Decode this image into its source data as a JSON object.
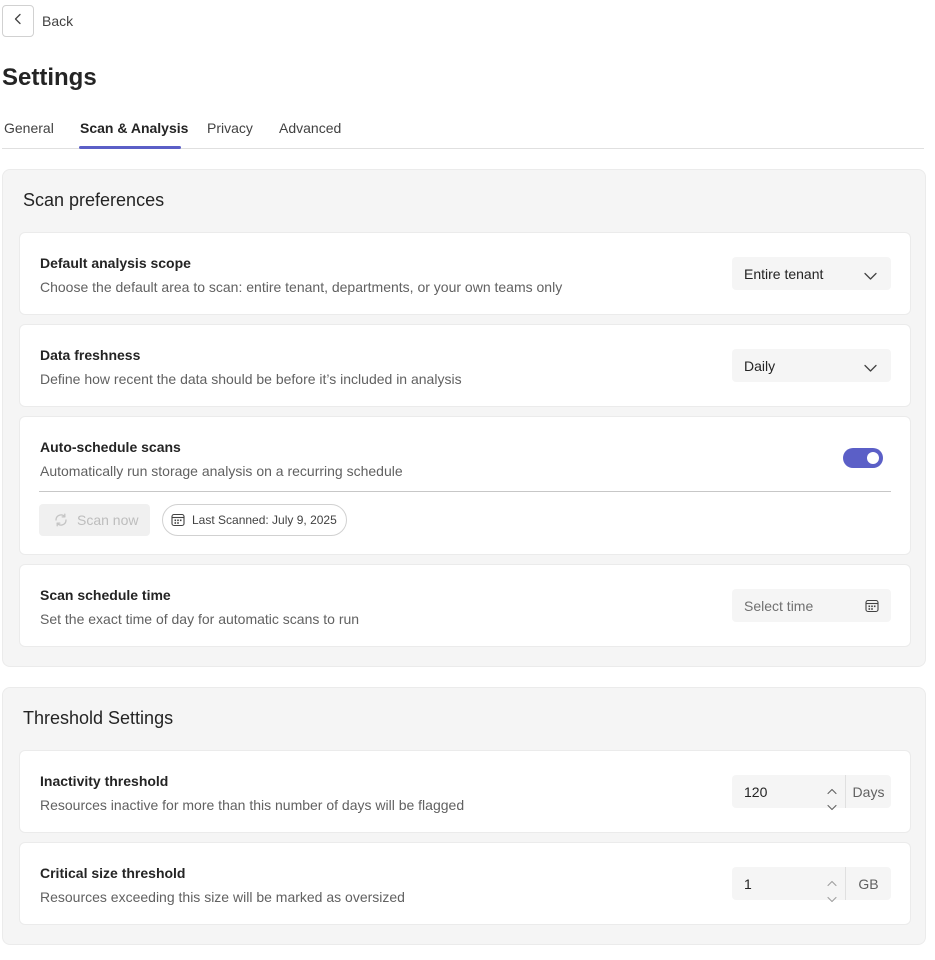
{
  "nav": {
    "back_label": "Back"
  },
  "page": {
    "title": "Settings"
  },
  "tabs": [
    {
      "label": "General"
    },
    {
      "label": "Scan & Analysis",
      "active": true
    },
    {
      "label": "Privacy"
    },
    {
      "label": "Advanced"
    }
  ],
  "colors": {
    "accent": "#5b5fc7",
    "section_bg": "#f5f5f5",
    "card_bg": "#ffffff"
  },
  "scan_preferences": {
    "title": "Scan preferences",
    "default_scope": {
      "title": "Default analysis scope",
      "description": "Choose the default area to scan: entire tenant, departments, or your own teams only",
      "selected": "Entire tenant",
      "icon": "chevron-down-icon"
    },
    "data_freshness": {
      "title": "Data freshness",
      "description": "Define how recent the data should be before it’s included in analysis",
      "selected": "Daily",
      "icon": "chevron-down-icon"
    },
    "auto_schedule": {
      "title": "Auto-schedule scans",
      "description": "Automatically run storage analysis on a recurring schedule",
      "enabled": true,
      "scan_now_label": "Scan now",
      "scan_now_disabled": true,
      "last_scanned": "Last Scanned: July 9, 2025"
    },
    "schedule_time": {
      "title": "Scan schedule time",
      "description": "Set the exact time of day for automatic scans to run",
      "placeholder": "Select time",
      "icon": "calendar-icon"
    }
  },
  "threshold_settings": {
    "title": "Threshold Settings",
    "inactivity": {
      "title": "Inactivity threshold",
      "description": "Resources inactive for more than this number of days will be flagged",
      "value": "120",
      "unit": "Days"
    },
    "critical_size": {
      "title": "Critical size threshold",
      "description": "Resources exceeding this size will be marked as oversized",
      "value": "1",
      "unit": "GB"
    }
  }
}
